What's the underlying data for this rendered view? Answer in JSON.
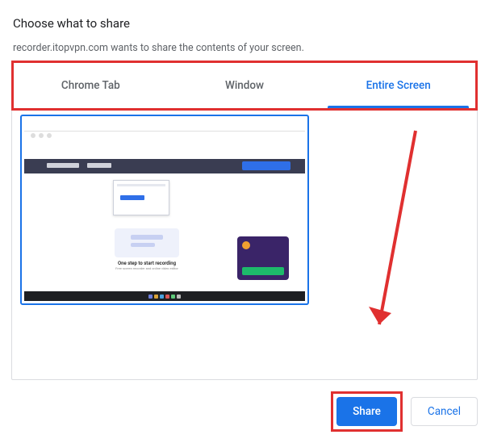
{
  "dialog": {
    "title": "Choose what to share",
    "subtitle": "recorder.itopvpn.com wants to share the contents of your screen."
  },
  "tabs": {
    "chrome": "Chrome Tab",
    "window": "Window",
    "entire": "Entire Screen",
    "active_index": 2
  },
  "preview": {
    "hero_title": "One step to start recording",
    "hero_sub": "Free screen recorder and online video editor"
  },
  "footer": {
    "share": "Share",
    "cancel": "Cancel"
  },
  "annotations": {
    "color": "#e03030"
  }
}
